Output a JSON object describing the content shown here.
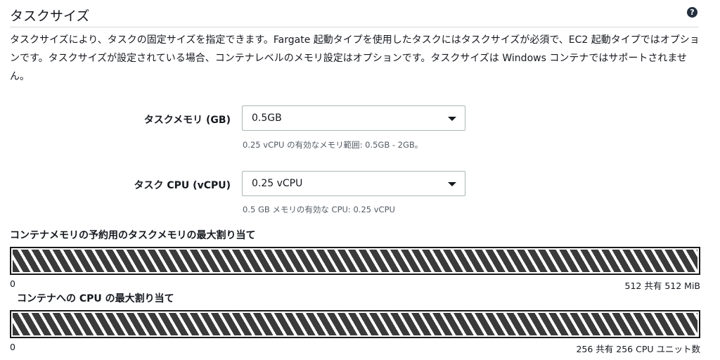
{
  "section": {
    "title": "タスクサイズ",
    "help_icon": "?",
    "description": "タスクサイズにより、タスクの固定サイズを指定できます。Fargate 起動タイプを使用したタスクにはタスクサイズが必須で、EC2 起動タイプではオプションです。タスクサイズが設定されている場合、コンテナレベルのメモリ設定はオプションです。タスクサイズは Windows コンテナではサポートされません。"
  },
  "memory": {
    "label": "タスクメモリ (GB)",
    "selected": "0.5GB",
    "hint": "0.25 vCPU の有効なメモリ範囲: 0.5GB - 2GB。"
  },
  "cpu": {
    "label": "タスク CPU (vCPU)",
    "selected": "0.25 vCPU",
    "hint": "0.5 GB メモリの有効な CPU: 0.25 vCPU"
  },
  "memory_allocation": {
    "title": "コンテナメモリの予約用のタスクメモリの最大割り当て",
    "min": "0",
    "max_label": "512 共有 512 MiB",
    "fill_fraction": 1.0
  },
  "cpu_allocation": {
    "title": "コンテナへの CPU の最大割り当て",
    "min": "0",
    "max_label": "256 共有 256 CPU ユニット数",
    "fill_fraction": 1.0
  },
  "colors": {
    "bar_stripe": "#3a3a3a",
    "bar_border": "#1a1a1a",
    "input_border": "#aab7b8",
    "hint_text": "#545b64"
  }
}
